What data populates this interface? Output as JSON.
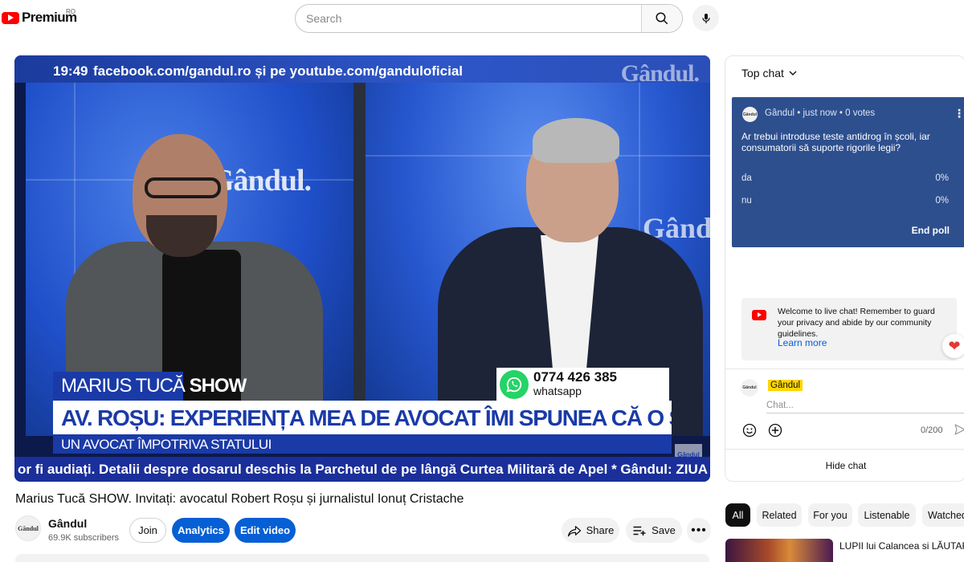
{
  "header": {
    "logo_text": "Premium",
    "country_code": "RO",
    "search_placeholder": "Search"
  },
  "video": {
    "clock": "19:49",
    "top_ticker": "facebook.com/gandul.ro și pe youtube.com/ganduloficial",
    "brand": "Gândul.",
    "show_name_light": "MARIUS TUCĂ ",
    "show_name_bold": "SHOW",
    "phone": "0774 426 385",
    "phone_label": "whatsapp",
    "headline": "AV. ROȘU: EXPERIENȚA MEA DE AVOCAT ÎMI SPUNEA CĂ O SĂ FIE BINE",
    "subheadline": "UN AVOCAT ÎMPOTRIVA STATULUI",
    "bottom_ticker": "or fi audiați. Detalii despre dosarul deschis la Parchetul de pe lângă Curtea Militară de Apel * Gândul: ZIUA DIPLO",
    "corner_badge": "Gândul"
  },
  "below_video": {
    "title": "Marius Tucă SHOW. Invitați: avocatul Robert Roșu și jurnalistul Ionuț Cristache",
    "channel_name": "Gândul",
    "subscribers": "69.9K subscribers",
    "avatar_text": "Gândul",
    "join_label": "Join",
    "analytics_label": "Analytics",
    "edit_label": "Edit video",
    "share_label": "Share",
    "save_label": "Save",
    "more_label": "•••"
  },
  "chat": {
    "header_label": "Top chat",
    "poll": {
      "author_meta": "Gândul • just now • 0 votes",
      "avatar_text": "Gândul",
      "question": "Ar trebui introduse teste antidrog în școli, iar consumatorii să suporte rigorile legii?",
      "options": [
        {
          "label": "da",
          "percent": "0%"
        },
        {
          "label": "nu",
          "percent": "0%"
        }
      ],
      "end_label": "End poll"
    },
    "welcome_text": "Welcome to live chat! Remember to guard your privacy and abide by our community guidelines.",
    "learn_more": "Learn more",
    "user_name": "Gândul",
    "user_avatar_text": "Gândul",
    "input_placeholder": "Chat...",
    "char_count": "0/200",
    "hide_chat_label": "Hide chat"
  },
  "chips": [
    "All",
    "Related",
    "For you",
    "Listenable",
    "Watched"
  ],
  "related": {
    "first_title": "LUPII lui Calancea si LĂUTARII"
  },
  "colors": {
    "youtube_red": "#ff0000",
    "accent_blue": "#065fd4",
    "poll_bg": "#2d4f8e",
    "broadcast_blue": "#1a3aa8"
  }
}
